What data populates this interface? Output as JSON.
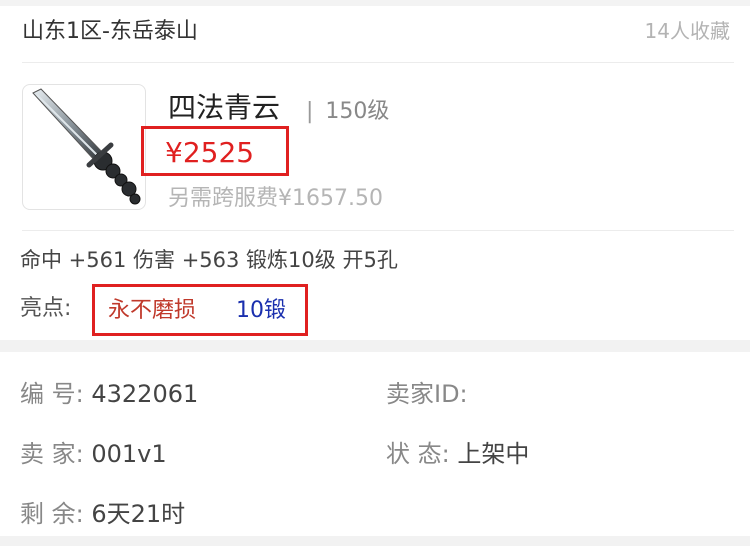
{
  "header": {
    "server": "山东1区-东岳泰山",
    "favorites": "14人收藏"
  },
  "item": {
    "icon": "sword-icon",
    "name": "四法青云",
    "level_sep": "|",
    "level": "150级",
    "price": "¥2525",
    "fee": "另需跨服费¥1657.50",
    "attributes": "命中 +561 伤害 +563 锻炼10级 开5孔",
    "highlight_label": "亮点:",
    "highlight_red": "永不磨损",
    "highlight_blue": "10锻",
    "highlight_red_color": "#c0392b",
    "highlight_blue_color": "#1a2fae",
    "price_color": "#e02020"
  },
  "details": {
    "id_label": "编  号:",
    "id_value": "4322061",
    "seller_id_label": "卖家ID:",
    "seller_id_value": "",
    "seller_label": "卖  家:",
    "seller_value": "001v1",
    "status_label": "状  态:",
    "status_value": "上架中",
    "remaining_label": "剩  余:",
    "remaining_value": "6天21时"
  }
}
